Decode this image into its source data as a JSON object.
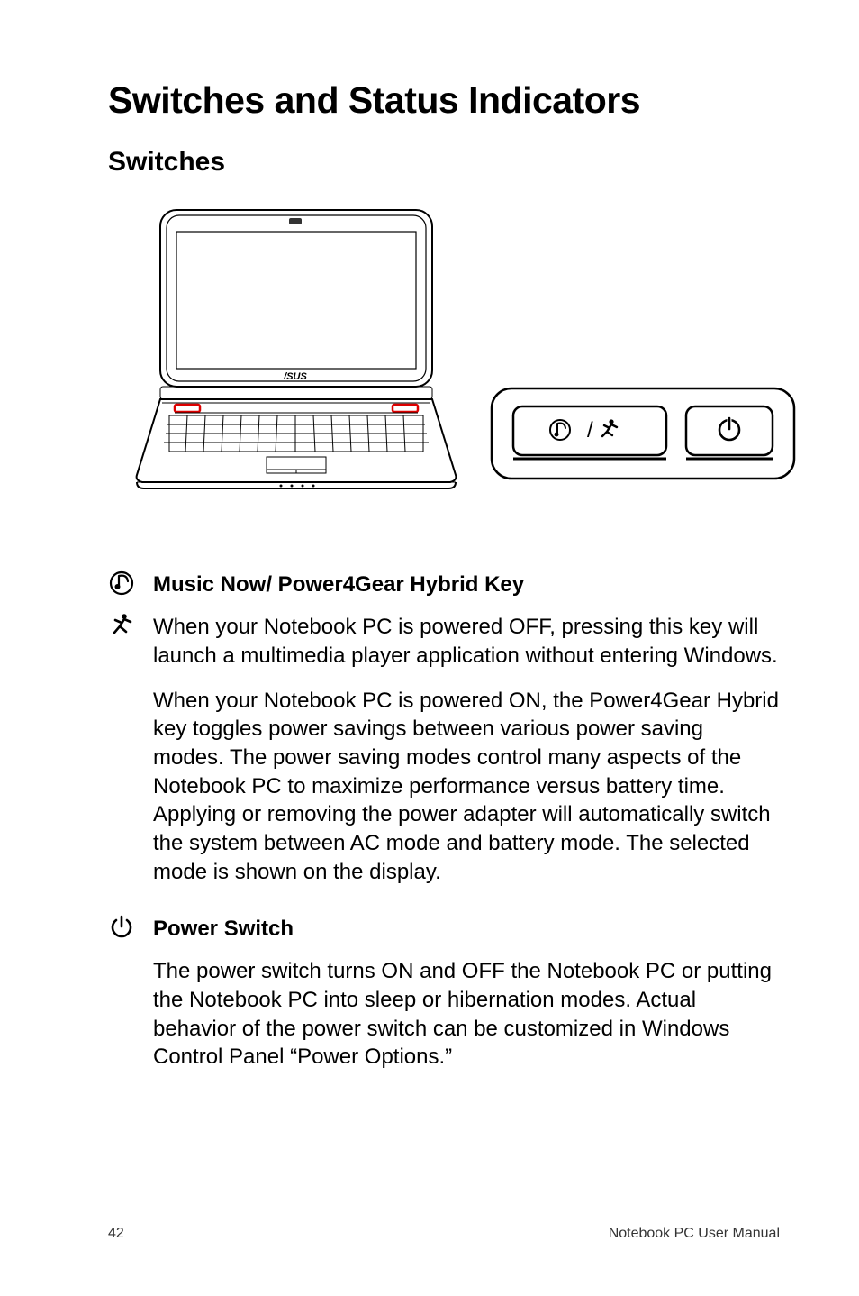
{
  "title": "Switches and Status Indicators",
  "subtitle": "Switches",
  "sections": {
    "music": {
      "heading": "Music Now/ Power4Gear Hybrid Key",
      "p1": "When your Notebook PC is powered OFF, pressing this key will launch a multimedia player application without entering Windows.",
      "p2": "When your Notebook PC is powered ON, the Power4Gear Hybrid key toggles power savings between various power saving modes. The power saving modes control many aspects of the Notebook PC to maximize performance versus battery time. Applying or removing the power adapter will automatically switch the system between AC mode and battery mode. The selected mode is shown on the display."
    },
    "power": {
      "heading": "Power Switch",
      "p1": "The power switch turns ON and OFF the Notebook PC or putting the Notebook PC into sleep or hibernation modes. Actual behavior of the power switch can be customized in Windows Control Panel “Power Options.”"
    }
  },
  "footer": {
    "page": "42",
    "manual": "Notebook PC User Manual"
  }
}
